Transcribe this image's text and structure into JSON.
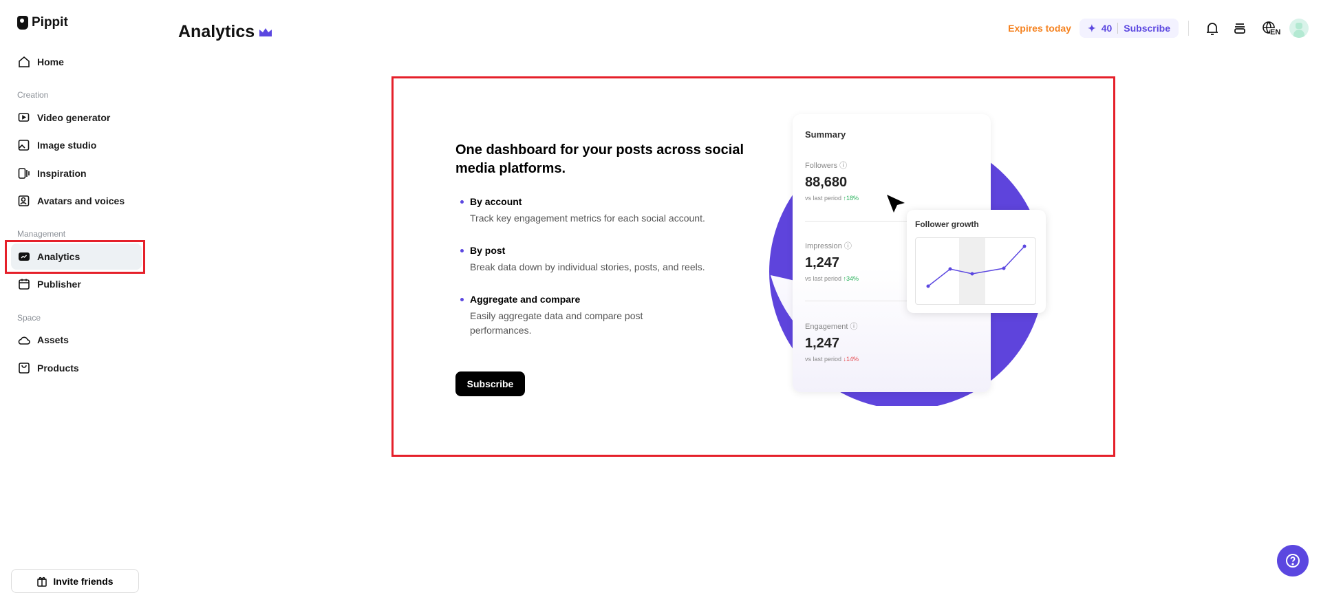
{
  "app": {
    "name": "Pippit"
  },
  "sidebar": {
    "home": "Home",
    "sections": {
      "creation": "Creation",
      "management": "Management",
      "space": "Space"
    },
    "items": {
      "video_generator": "Video generator",
      "image_studio": "Image studio",
      "inspiration": "Inspiration",
      "avatars_voices": "Avatars and voices",
      "analytics": "Analytics",
      "publisher": "Publisher",
      "assets": "Assets",
      "products": "Products"
    },
    "invite": "Invite friends"
  },
  "header": {
    "title": "Analytics",
    "expires": "Expires today",
    "credits": "40",
    "subscribe": "Subscribe",
    "language": "EN"
  },
  "promo": {
    "heading": "One dashboard for your posts across social media platforms.",
    "features": [
      {
        "title": "By account",
        "desc": "Track key engagement metrics for each social account."
      },
      {
        "title": "By post",
        "desc": "Break data down by individual stories, posts, and reels."
      },
      {
        "title": "Aggregate and compare",
        "desc": "Easily aggregate data and compare post performances."
      }
    ],
    "subscribe": "Subscribe"
  },
  "illustration": {
    "summary_title": "Summary",
    "metrics": [
      {
        "label": "Followers",
        "value": "88,680",
        "compare": "vs last period",
        "change": "↑18%"
      },
      {
        "label": "Impression",
        "value": "1,247",
        "compare": "vs last period",
        "change": "↑34%"
      },
      {
        "label": "Engagement",
        "value": "1,247",
        "compare": "vs last period",
        "change": "↓14%"
      }
    ],
    "growth_title": "Follower growth",
    "growth_points": [
      20,
      45,
      38,
      46,
      78
    ]
  },
  "colors": {
    "accent": "#5b47e0",
    "expires": "#f5821f",
    "highlight": "#e5202a",
    "up": "#27b05a",
    "down": "#e5484d"
  }
}
